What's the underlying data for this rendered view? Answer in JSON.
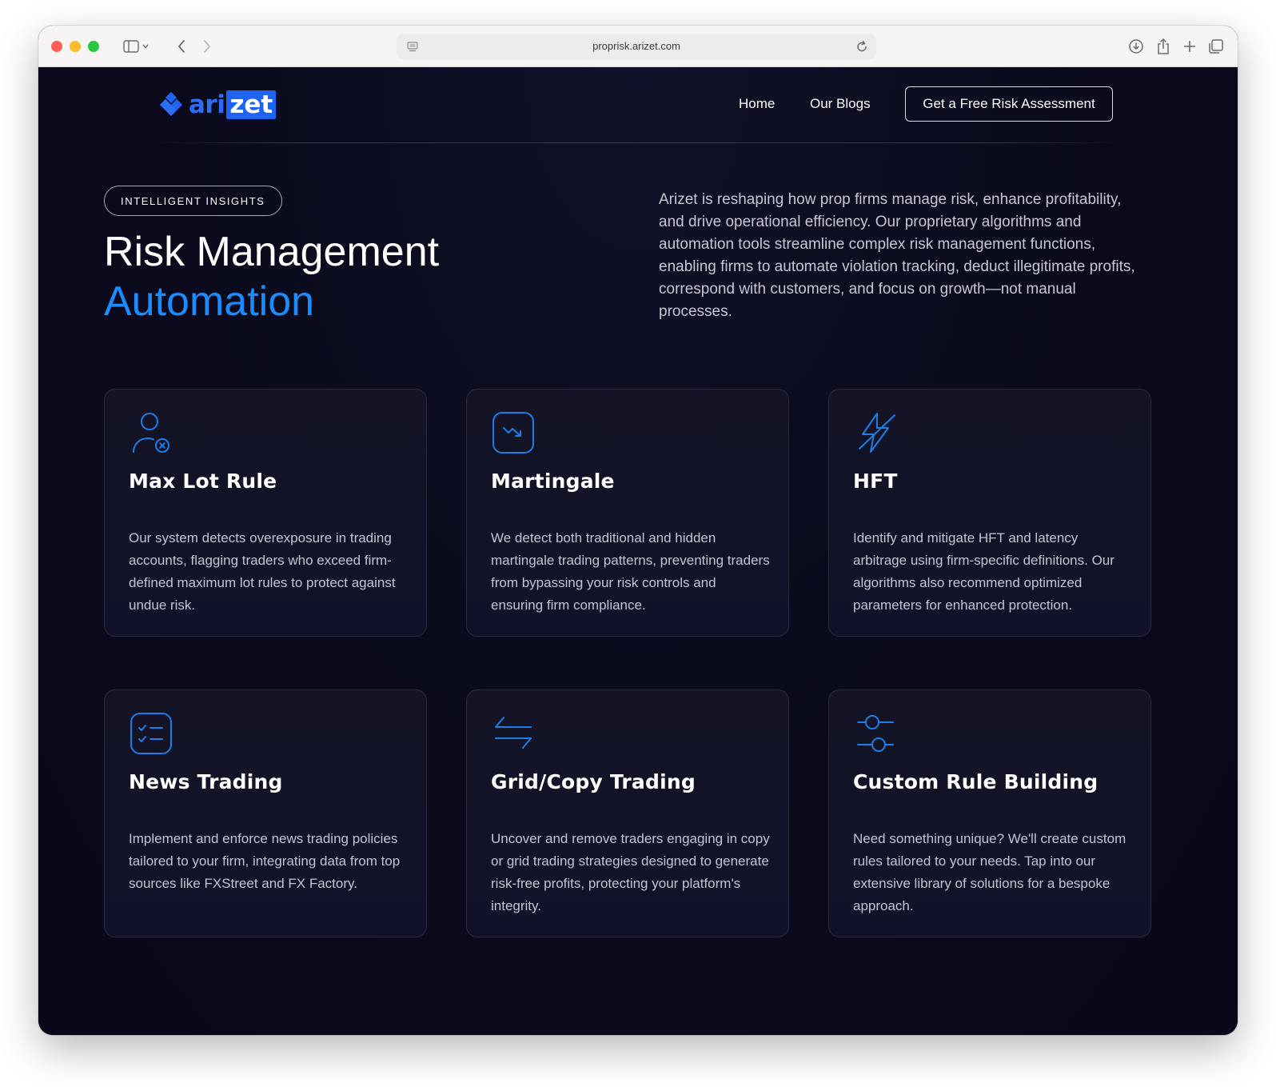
{
  "browser": {
    "url": "proprisk.arizet.com"
  },
  "nav": {
    "logo_part1": "ari",
    "logo_part2": "zet",
    "links": [
      "Home",
      "Our Blogs"
    ],
    "cta": "Get a Free Risk Assessment"
  },
  "hero": {
    "pill": "INTELLIGENT INSIGHTS",
    "title_line1": "Risk Management",
    "title_line2": "Automation",
    "description": "Arizet is reshaping how prop firms manage risk, enhance profitability, and drive operational efficiency. Our proprietary algorithms and automation tools streamline complex risk management functions, enabling firms to automate violation tracking, deduct illegitimate profits, correspond with customers, and focus on growth—not manual processes.",
    "accent_color": "#1a8cff"
  },
  "cards": [
    {
      "icon": "user-x-icon",
      "title": "Max Lot Rule",
      "text": "Our system detects overexposure in trading accounts, flagging traders who exceed firm-defined maximum lot rules to protect against undue risk."
    },
    {
      "icon": "trend-down-icon",
      "title": "Martingale",
      "text": "We detect both traditional and hidden martingale trading patterns, preventing traders from bypassing your risk controls and ensuring firm compliance."
    },
    {
      "icon": "flash-off-icon",
      "title": "HFT",
      "text": "Identify and mitigate HFT and latency arbitrage using firm-specific definitions. Our algorithms also recommend optimized parameters for enhanced protection."
    },
    {
      "icon": "checklist-icon",
      "title": "News Trading",
      "text": "Implement and enforce news trading policies tailored to your firm, integrating data from top sources like FXStreet and FX Factory."
    },
    {
      "icon": "arrows-swap-icon",
      "title": "Grid/Copy Trading",
      "text": "Uncover and remove traders engaging in copy or grid trading strategies designed to generate risk-free profits, protecting your platform's integrity."
    },
    {
      "icon": "sliders-icon",
      "title": "Custom Rule Building",
      "text": "Need something unique? We'll create custom rules tailored to your needs. Tap into our extensive library of solutions for a bespoke approach."
    }
  ]
}
